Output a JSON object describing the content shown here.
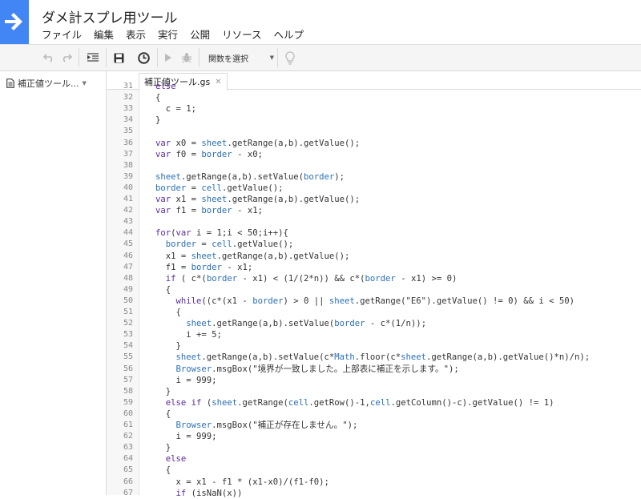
{
  "app": {
    "title": "ダメ計スプレ用ツール",
    "menu": [
      "ファイル",
      "編集",
      "表示",
      "実行",
      "公開",
      "リソース",
      "ヘルプ"
    ]
  },
  "toolbar": {
    "function_select": "関数を選択",
    "icons": [
      "undo-icon",
      "redo-icon",
      "indent-icon",
      "save-icon",
      "clock-icon",
      "run-icon",
      "debug-icon",
      "lightbulb-icon"
    ]
  },
  "sidebar": {
    "file": "補正値ツール..."
  },
  "editor": {
    "tab": "補正値ツール.gs",
    "lines": [
      {
        "n": "31",
        "code": "else"
      },
      {
        "n": "32",
        "code": "{"
      },
      {
        "n": "33",
        "code": "  c = 1;"
      },
      {
        "n": "34",
        "code": "}"
      },
      {
        "n": "35",
        "code": ""
      },
      {
        "n": "36",
        "code": "var x0 = sheet.getRange(a,b).getValue();"
      },
      {
        "n": "37",
        "code": "var f0 = border - x0;"
      },
      {
        "n": "38",
        "code": ""
      },
      {
        "n": "39",
        "code": "sheet.getRange(a,b).setValue(border);"
      },
      {
        "n": "40",
        "code": "border = cell.getValue();"
      },
      {
        "n": "41",
        "code": "var x1 = sheet.getRange(a,b).getValue();"
      },
      {
        "n": "42",
        "code": "var f1 = border - x1;"
      },
      {
        "n": "43",
        "code": ""
      },
      {
        "n": "44",
        "code": "for(var i = 1;i < 50;i++){"
      },
      {
        "n": "45",
        "code": "  border = cell.getValue();"
      },
      {
        "n": "46",
        "code": "  x1 = sheet.getRange(a,b).getValue();"
      },
      {
        "n": "47",
        "code": "  f1 = border - x1;"
      },
      {
        "n": "48",
        "code": "  if ( c*(border - x1) < (1/(2*n)) && c*(border - x1) >= 0)"
      },
      {
        "n": "49",
        "code": "  {"
      },
      {
        "n": "50",
        "code": "    while((c*(x1 - border) > 0 || sheet.getRange(\"E6\").getValue() != 0) && i < 50)"
      },
      {
        "n": "51",
        "code": "    {"
      },
      {
        "n": "52",
        "code": "      sheet.getRange(a,b).setValue(border - c*(1/n));"
      },
      {
        "n": "53",
        "code": "      i += 5;"
      },
      {
        "n": "54",
        "code": "    }"
      },
      {
        "n": "55",
        "code": "    sheet.getRange(a,b).setValue(c*Math.floor(c*sheet.getRange(a,b).getValue()*n)/n);"
      },
      {
        "n": "56",
        "code": "    Browser.msgBox(\"境界が一致しました。上部表に補正を示します。\");"
      },
      {
        "n": "57",
        "code": "    i = 999;"
      },
      {
        "n": "58",
        "code": "  }"
      },
      {
        "n": "59",
        "code": "  else if (sheet.getRange(cell.getRow()-1,cell.getColumn()-c).getValue() != 1)"
      },
      {
        "n": "60",
        "code": "  {"
      },
      {
        "n": "61",
        "code": "    Browser.msgBox(\"補正が存在しません。\");"
      },
      {
        "n": "62",
        "code": "    i = 999;"
      },
      {
        "n": "63",
        "code": "  }"
      },
      {
        "n": "64",
        "code": "  else"
      },
      {
        "n": "65",
        "code": "  {"
      },
      {
        "n": "66",
        "code": "    x = x1 - f1 * (x1-x0)/(f1-f0);"
      },
      {
        "n": "67",
        "code": "    if (isNaN(x))"
      }
    ]
  }
}
